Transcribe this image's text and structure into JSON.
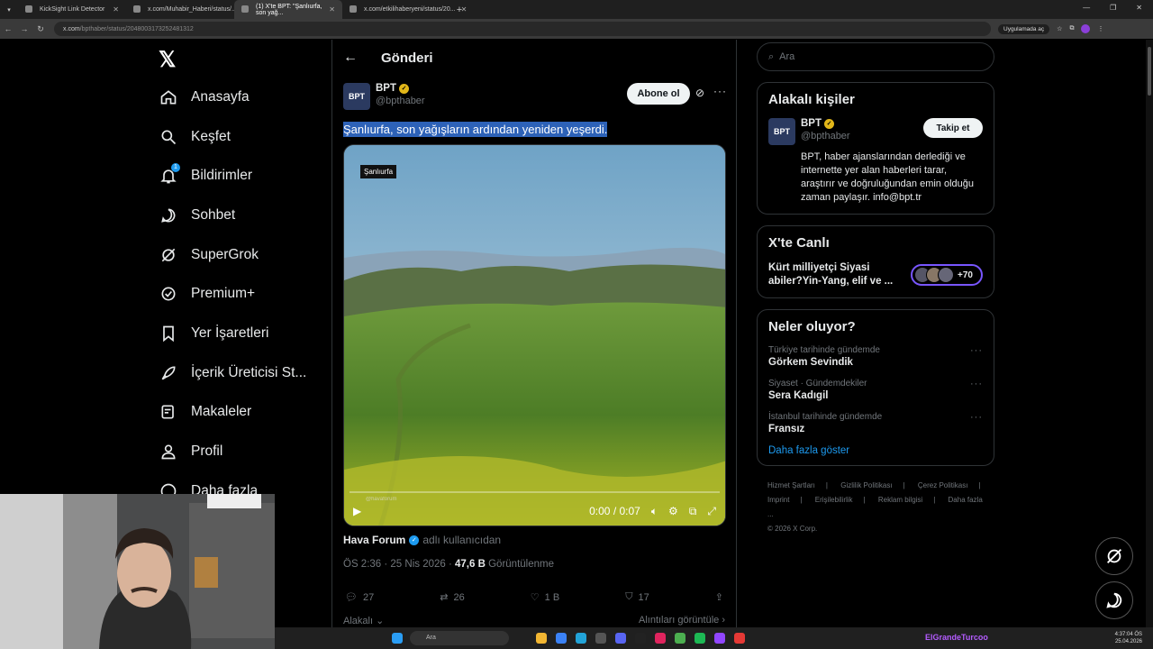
{
  "browser": {
    "tabs": [
      {
        "title": "KickSight Link Detector"
      },
      {
        "title": "x.com/Muhabir_Haberi/status/..."
      },
      {
        "title": "(1) X'te BPT: \"Şanlıurfa, son yağ..."
      },
      {
        "title": "x.com/etkilihaberyeni/status/20..."
      }
    ],
    "url_host": "x.com",
    "url_path": "/bpthaber/status/2048003173252481312",
    "app_pill": "Uygulamada aç"
  },
  "nav": {
    "items": [
      {
        "label": "Anasayfa",
        "icon": "home-icon"
      },
      {
        "label": "Keşfet",
        "icon": "search-icon"
      },
      {
        "label": "Bildirimler",
        "icon": "bell-icon"
      },
      {
        "label": "Sohbet",
        "icon": "chat-icon"
      },
      {
        "label": "SuperGrok",
        "icon": "grok-icon"
      },
      {
        "label": "Premium+",
        "icon": "verified-icon"
      },
      {
        "label": "Yer İşaretleri",
        "icon": "bookmark-icon"
      },
      {
        "label": "İçerik Üreticisi St...",
        "icon": "rocket-icon"
      },
      {
        "label": "Makaleler",
        "icon": "article-icon"
      },
      {
        "label": "Profil",
        "icon": "person-icon"
      },
      {
        "label": "Daha fazla",
        "icon": "more-icon"
      }
    ],
    "notif_count": "1"
  },
  "post": {
    "header_title": "Gönderi",
    "author_name": "BPT",
    "author_handle": "@bpthaber",
    "subscribe_label": "Abone ol",
    "text": "Şanlıurfa, son yağışların ardından yeniden yeşerdi.",
    "media_tag": "Şanlıurfa",
    "watermark": "@havaforum",
    "video_time": "0:00 / 0:07",
    "progress": 0,
    "attribution_name": "Hava Forum",
    "attribution_suffix": "adlı kullanıcıdan",
    "time": "ÖS 2:36 · 25 Nis 2026 ·",
    "views": "47,6 B",
    "views_label": "Görüntülenme",
    "replies": "27",
    "reposts": "26",
    "likes": "1 B",
    "bookmarks": "17",
    "relevant_label": "Alakalı",
    "quotes_label": "Alıntıları görüntüle"
  },
  "right": {
    "search_placeholder": "Ara",
    "related_title": "Alakalı kişiler",
    "person_name": "BPT",
    "person_handle": "@bpthaber",
    "follow_label": "Takip et",
    "person_bio": "BPT, haber ajanslarından derlediği ve internette yer alan haberleri tarar, araştırır ve doğruluğundan emin olduğu zaman paylaşır. info@bpt.tr",
    "live_title": "X'te Canlı",
    "live_text": "Kürt milliyetçi Siyasi abiler?Yin-Yang, elif ve ...",
    "live_count": "+70",
    "trends_title": "Neler oluyor?",
    "trends": [
      {
        "context": "Türkiye tarihinde gündemde",
        "title": "Görkem Sevindik"
      },
      {
        "context": "Siyaset · Gündemdekiler",
        "title": "Sera Kadıgil"
      },
      {
        "context": "İstanbul tarihinde gündemde",
        "title": "Fransız"
      }
    ],
    "show_more": "Daha fazla göster",
    "legal_row1": [
      "Hizmet Şartları",
      "|",
      "Gizlilik Politikası",
      "|",
      "Çerez Politikası",
      "|"
    ],
    "legal_row2": [
      "Imprint",
      "|",
      "Erişilebilirlik",
      "|",
      "Reklam bilgisi",
      "|",
      "Daha fazla ..."
    ],
    "copyright": "© 2026 X Corp."
  },
  "taskbar": {
    "search": "Ara",
    "user": "ElGrandeTurcoo",
    "time": "4:37:04 ÖS",
    "date": "25.04.2026"
  },
  "colors": {
    "accent": "#1d9bf0",
    "gold": "#e2b719",
    "selection": "#2d62b8",
    "live": "#7856ff"
  }
}
